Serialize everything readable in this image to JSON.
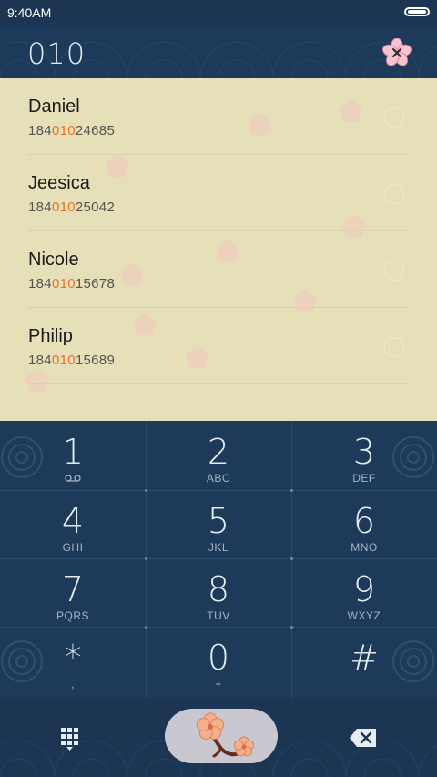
{
  "status_bar": {
    "time": "9:40AM"
  },
  "header": {
    "dialed_number": "010"
  },
  "contacts": [
    {
      "name": "Daniel",
      "number_prefix": "184",
      "number_match": "010",
      "number_suffix": "24685"
    },
    {
      "name": "Jeesica",
      "number_prefix": "184",
      "number_match": "010",
      "number_suffix": "25042"
    },
    {
      "name": "Nicole",
      "number_prefix": "184",
      "number_match": "010",
      "number_suffix": "15678"
    },
    {
      "name": "Philip",
      "number_prefix": "184",
      "number_match": "010",
      "number_suffix": "15689"
    }
  ],
  "keypad": [
    {
      "digit": "1",
      "letters": ""
    },
    {
      "digit": "2",
      "letters": "ABC"
    },
    {
      "digit": "3",
      "letters": "DEF"
    },
    {
      "digit": "4",
      "letters": "GHI"
    },
    {
      "digit": "5",
      "letters": "JKL"
    },
    {
      "digit": "6",
      "letters": "MNO"
    },
    {
      "digit": "7",
      "letters": "PQRS"
    },
    {
      "digit": "8",
      "letters": "TUV"
    },
    {
      "digit": "9",
      "letters": "WXYZ"
    },
    {
      "digit": "*",
      "letters": ","
    },
    {
      "digit": "0",
      "letters": "+"
    },
    {
      "digit": "#",
      "letters": ""
    }
  ],
  "icons": {
    "clear": "sakura-clear-icon",
    "voicemail": "voicemail-icon",
    "dialpad": "dialpad-grid-icon",
    "call": "plum-blossom-call-icon",
    "backspace": "backspace-icon"
  },
  "colors": {
    "background": "#1d3a5a",
    "list_background": "#e5e0b8",
    "match_highlight": "#e8722a",
    "call_button": "#c9c7cf"
  }
}
